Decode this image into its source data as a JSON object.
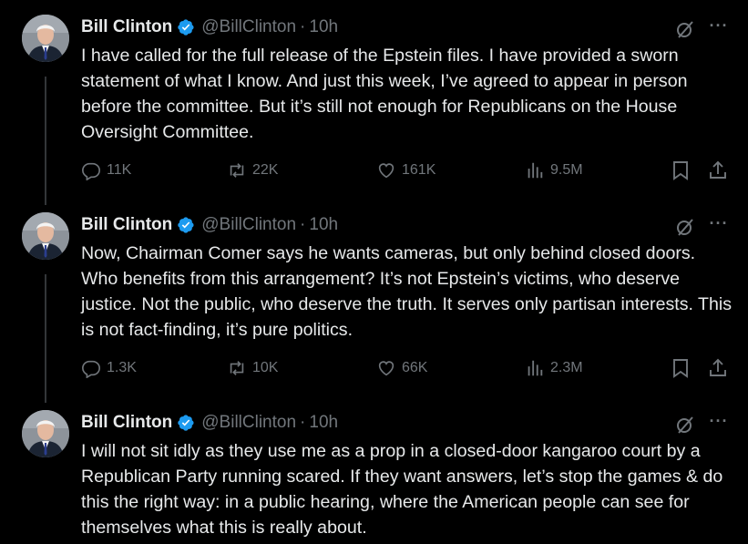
{
  "tweets": [
    {
      "name": "Bill Clinton",
      "handle": "@BillClinton",
      "separator": "·",
      "time": "10h",
      "more": "···",
      "text": "I have called for the full release of the Epstein files. I have provided a sworn statement of what I know. And just this week, I’ve agreed to appear in person before the committee. But it’s still not enough for Republicans on the House Oversight Committee.",
      "replies": "11K",
      "reposts": "22K",
      "likes": "161K",
      "views": "9.5M"
    },
    {
      "name": "Bill Clinton",
      "handle": "@BillClinton",
      "separator": "·",
      "time": "10h",
      "more": "···",
      "text": "Now, Chairman Comer says he wants cameras, but only behind closed doors. Who benefits from this arrangement? It’s not Epstein’s victims, who deserve justice. Not the public, who deserve the truth. It serves only partisan interests. This is not fact-finding, it’s pure politics.",
      "replies": "1.3K",
      "reposts": "10K",
      "likes": "66K",
      "views": "2.3M"
    },
    {
      "name": "Bill Clinton",
      "handle": "@BillClinton",
      "separator": "·",
      "time": "10h",
      "more": "···",
      "text": "I will not sit idly as they use me as a prop in a closed-door kangaroo court by a Republican Party running scared. If they want answers, let’s stop the games & do this the right way: in a public hearing, where the American people can see for themselves what this is really about."
    }
  ],
  "colors": {
    "background": "#000000",
    "text": "#e7e9ea",
    "muted": "#71767b",
    "verified": "#1d9bf0",
    "thread_line": "#333639"
  },
  "icons": {
    "verified": "verified-badge-icon",
    "grok": "grok-icon",
    "more": "more-icon",
    "reply": "reply-icon",
    "repost": "repost-icon",
    "like": "like-icon",
    "views": "views-icon",
    "bookmark": "bookmark-icon",
    "share": "share-icon"
  }
}
